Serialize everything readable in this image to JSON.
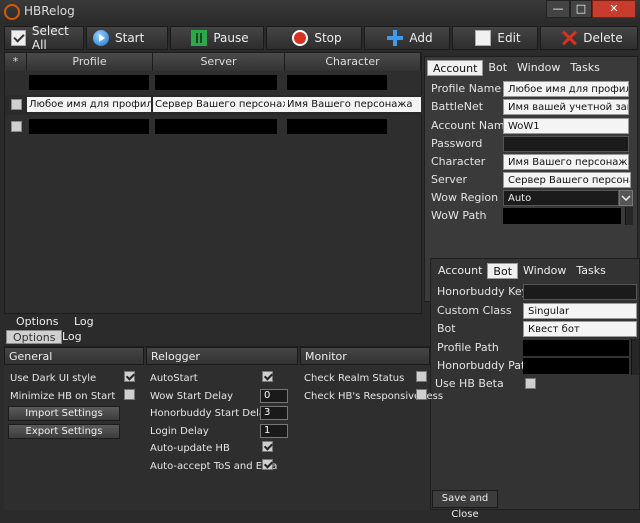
{
  "window": {
    "title": "HBRelog",
    "minimize": "—",
    "maximize": "□",
    "close": "✕"
  },
  "toolbar": {
    "select_all": "Select All",
    "start": "Start",
    "pause": "Pause",
    "stop": "Stop",
    "add": "Add",
    "edit": "Edit",
    "delete": "Delete"
  },
  "grid": {
    "header_marker": "*",
    "columns": [
      "Profile",
      "Server",
      "Character"
    ],
    "rows": [
      {
        "profile": "",
        "server": "",
        "character": ""
      },
      {
        "profile": "Любое имя для профиля",
        "server": "Сервер Вашего персонажа",
        "character": "Имя Вашего персонажа"
      },
      {
        "profile": "",
        "server": "",
        "character": ""
      }
    ]
  },
  "account_panel": {
    "tabs": [
      "Account",
      "Bot",
      "Window",
      "Tasks"
    ],
    "fields": [
      {
        "label": "Profile Name",
        "value": "Любое имя для профиля"
      },
      {
        "label": "BattleNet",
        "value": "Имя вашей учетной запис"
      },
      {
        "label": "Account Name",
        "value": "WoW1"
      },
      {
        "label": "Password",
        "value": ""
      },
      {
        "label": "Character",
        "value": "Имя Вашего персонажа"
      },
      {
        "label": "Server",
        "value": "Сервер Вашего персонаж"
      },
      {
        "label": "Wow Region",
        "value": "Auto"
      },
      {
        "label": "WoW Path",
        "value": ""
      }
    ]
  },
  "bot_panel": {
    "tabs": [
      "Account",
      "Bot",
      "Window",
      "Tasks"
    ],
    "fields": [
      {
        "label": "Honorbuddy Key",
        "value": ""
      },
      {
        "label": "Custom Class",
        "value": "Singular"
      },
      {
        "label": "Bot",
        "value": "Квест бот"
      },
      {
        "label": "Profile Path",
        "value": ""
      },
      {
        "label": "Honorbuddy Path",
        "value": ""
      }
    ],
    "use_hb_beta": "Use HB Beta",
    "save_close": "Save and Close"
  },
  "bottom_tabs": {
    "options": "Options",
    "log": "Log",
    "options_ghost": "Options",
    "log_ghost": "Log"
  },
  "options": {
    "general": {
      "header": "General",
      "dark_ui": "Use Dark UI style",
      "minimize": "Minimize HB on Start",
      "import_btn": "Import Settings",
      "export_btn": "Export Settings"
    },
    "relogger": {
      "header": "Relogger",
      "autostart": "AutoStart",
      "wow_delay": "Wow Start Delay",
      "wow_delay_val": "0",
      "hb_delay": "Honorbuddy Start Delay",
      "hb_delay_val": "3",
      "login_delay": "Login Delay",
      "login_delay_val": "1",
      "auto_update": "Auto-update HB",
      "auto_accept": "Auto-accept ToS and Eula"
    },
    "monitor": {
      "header": "Monitor",
      "realm_status": "Check Realm Status",
      "responsiveness": "Check HB's Responsiveness"
    }
  },
  "colors": {
    "accent_close": "#c73c2d",
    "background": "#2b2b2b",
    "highlight_row": "#f4f4f4"
  }
}
